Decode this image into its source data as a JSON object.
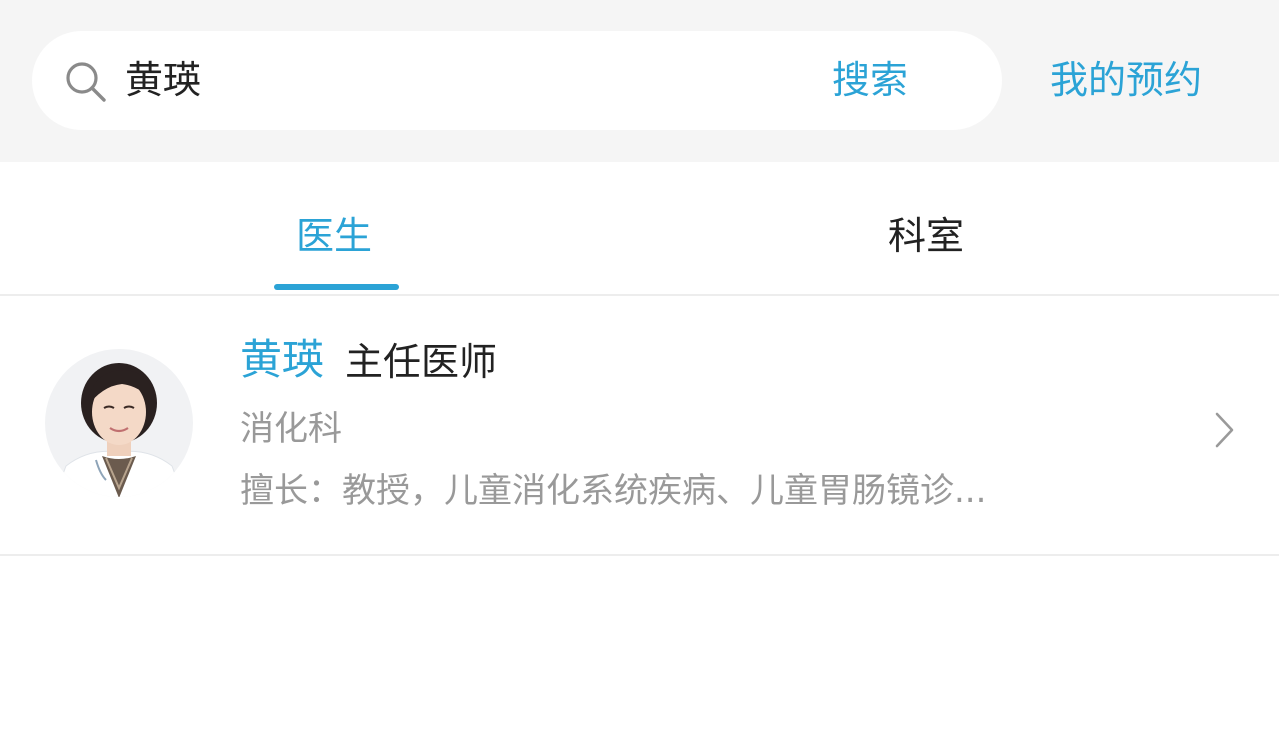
{
  "search": {
    "query": "黄瑛",
    "button_label": "搜索",
    "icon": "search-icon"
  },
  "header": {
    "my_appointments_label": "我的预约"
  },
  "tabs": [
    {
      "label": "医生",
      "active": true
    },
    {
      "label": "科室",
      "active": false
    }
  ],
  "results": [
    {
      "name": "黄瑛",
      "title": "主任医师",
      "department": "消化科",
      "specialty": "擅长：教授，儿童消化系统疾病、儿童胃肠镜诊...",
      "avatar": "doctor-photo",
      "chevron": "chevron-right-icon"
    }
  ],
  "colors": {
    "accent": "#2ba3d6",
    "header_bg": "#f5f5f5",
    "text_primary": "#222222",
    "text_secondary": "#999999",
    "divider": "#ededed"
  }
}
